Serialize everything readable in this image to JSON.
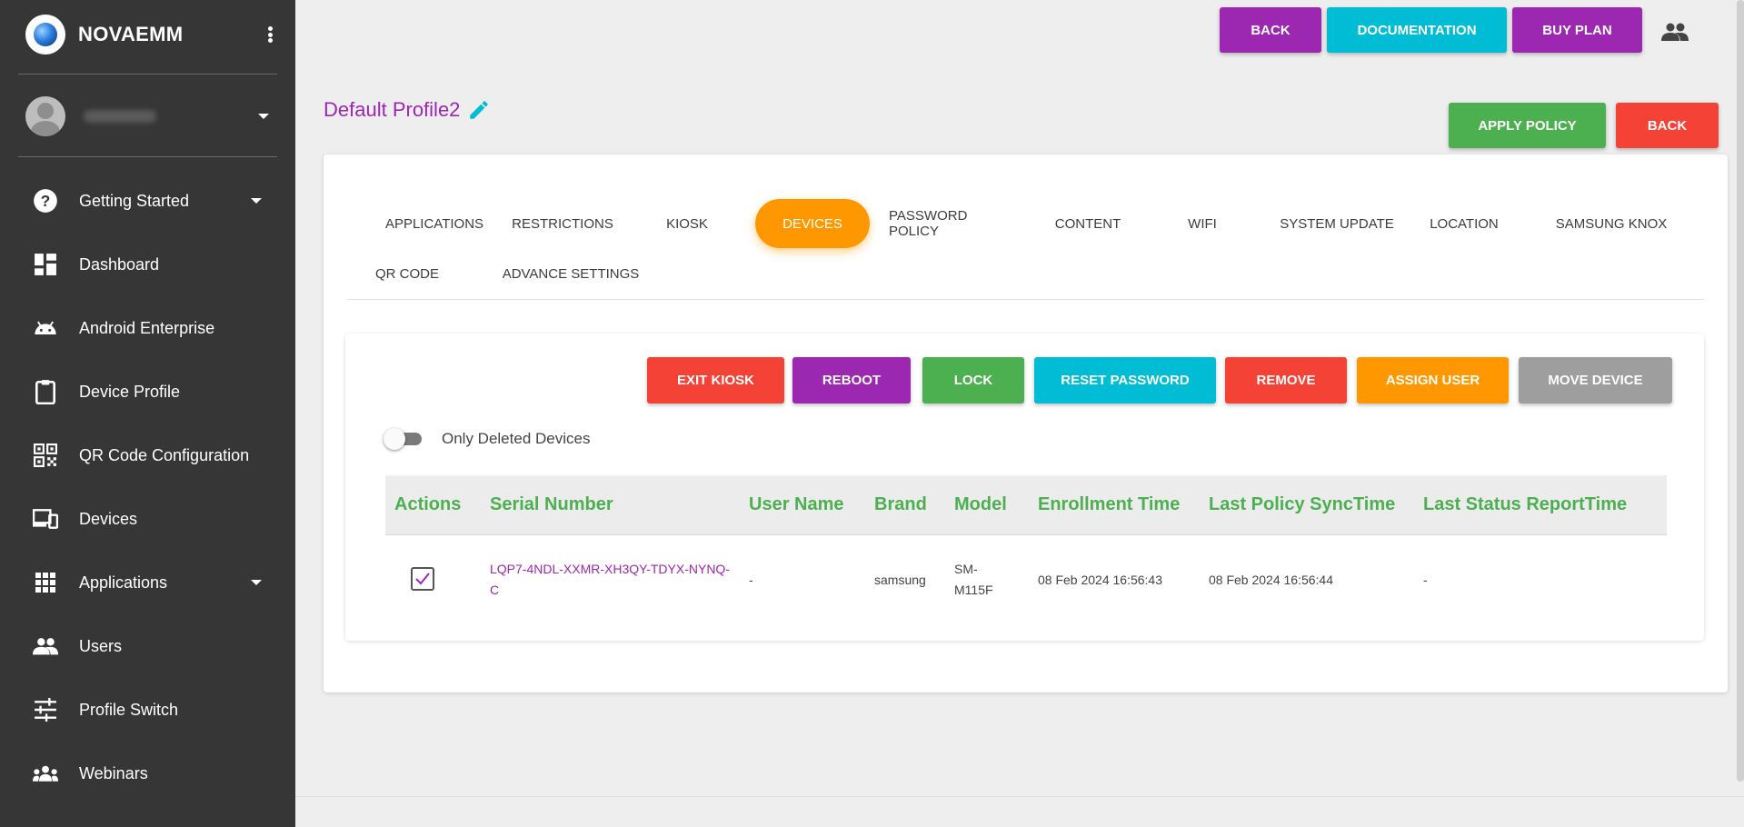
{
  "sidebar": {
    "brand": "NOVAEMM",
    "user_name": "",
    "items": [
      {
        "label": "Getting Started",
        "icon": "help-circle-icon",
        "has_caret": true
      },
      {
        "label": "Dashboard",
        "icon": "dashboard-icon",
        "has_caret": false
      },
      {
        "label": "Android Enterprise",
        "icon": "android-icon",
        "has_caret": false
      },
      {
        "label": "Device Profile",
        "icon": "clipboard-icon",
        "has_caret": false
      },
      {
        "label": "QR Code Configuration",
        "icon": "qr-code-icon",
        "has_caret": false
      },
      {
        "label": "Devices",
        "icon": "devices-icon",
        "has_caret": false
      },
      {
        "label": "Applications",
        "icon": "apps-grid-icon",
        "has_caret": true
      },
      {
        "label": "Users",
        "icon": "people-icon",
        "has_caret": false
      },
      {
        "label": "Profile Switch",
        "icon": "tune-icon",
        "has_caret": false
      },
      {
        "label": "Webinars",
        "icon": "groups-icon",
        "has_caret": false
      }
    ]
  },
  "topbar": {
    "back": "BACK",
    "documentation": "DOCUMENTATION",
    "buy_plan": "BUY PLAN"
  },
  "profile": {
    "title": "Default Profile2",
    "apply_policy": "APPLY POLICY",
    "back": "BACK"
  },
  "tabs": [
    {
      "label": "APPLICATIONS",
      "active": false
    },
    {
      "label": "RESTRICTIONS",
      "active": false
    },
    {
      "label": "KIOSK",
      "active": false
    },
    {
      "label": "DEVICES",
      "active": true
    },
    {
      "label": "PASSWORD POLICY",
      "active": false
    },
    {
      "label": "CONTENT",
      "active": false
    },
    {
      "label": "WIFI",
      "active": false
    },
    {
      "label": "SYSTEM UPDATE",
      "active": false
    },
    {
      "label": "LOCATION",
      "active": false
    },
    {
      "label": "SAMSUNG KNOX",
      "active": false
    },
    {
      "label": "QR CODE",
      "active": false
    },
    {
      "label": "ADVANCE SETTINGS",
      "active": false
    }
  ],
  "device_actions": {
    "exit_kiosk": "EXIT KIOSK",
    "reboot": "REBOOT",
    "lock": "LOCK",
    "reset_password": "RESET PASSWORD",
    "remove": "REMOVE",
    "assign_user": "ASSIGN USER",
    "move_device": "MOVE DEVICE"
  },
  "filter": {
    "only_deleted_label": "Only Deleted Devices",
    "only_deleted_on": false
  },
  "table": {
    "headers": {
      "actions": "Actions",
      "serial": "Serial Number",
      "user": "User Name",
      "brand": "Brand",
      "model": "Model",
      "enrollment": "Enrollment Time",
      "policy_sync": "Last Policy SyncTime",
      "status_report": "Last Status ReportTime"
    },
    "rows": [
      {
        "checked": true,
        "serial_line1": "LQP7-4NDL-XXMR-XH3QY-TDYX-NYNQ-",
        "serial_line2": "C",
        "user": "-",
        "brand": "samsung",
        "model_line1": "SM-",
        "model_line2": "M115F",
        "enrollment": "08 Feb 2024 16:56:43",
        "policy_sync": "08 Feb 2024 16:56:44",
        "status_report": "-"
      }
    ]
  },
  "colors": {
    "sidebar_bg": "#363636",
    "purple": "#9c27b0",
    "cyan": "#00bcd4",
    "green": "#4caf50",
    "red": "#f44336",
    "orange": "#ff9800",
    "grey": "#9e9e9e"
  }
}
